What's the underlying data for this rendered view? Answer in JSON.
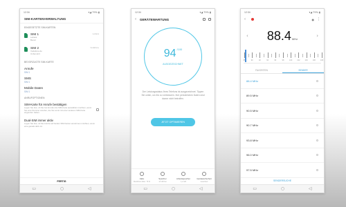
{
  "phone1": {
    "status": {
      "left": "12:34",
      "right": "▾◢ 79% ▮"
    },
    "title": "SIM-KARTENVERWALTUNG",
    "section_installed": "EINGESETZTE SIM-KARTEN",
    "sims": [
      {
        "name": "SIM 1",
        "sub": "Lebara\nBereit",
        "side": "Lebara"
      },
      {
        "name": "SIM 2",
        "sub": "Vodafone.de\nUnbenutzt",
        "side": "Vodafone"
      }
    ],
    "section_preferred": "BEVORZUGTE SIM-KARTE",
    "settings": [
      {
        "title": "Anrufe",
        "sub": "SIM 1"
      },
      {
        "title": "SMS",
        "sub": "SIM 1"
      },
      {
        "title": "Mobile Daten",
        "sub": "SIM 1"
      }
    ],
    "section_more": "ANRUFOPTIONEN",
    "long_items": [
      {
        "title": "SIM-Karte für Anrufe bestätigen",
        "desc": "Legen Sie fest, ob Sie bei Anrufen die SIM-Karte auswählen möchten, wenn Sie eine Nummer anrufen, die Sie sonst mit einer anderen SIM-Karte angerufen haben."
      },
      {
        "title": "Dual-SIM immer aktiv",
        "desc": "Legen Sie fest, ob Sie Anrufe auf beiden SIM-Karten annehmen möchten, wenn eine gerade aktiv ist."
      }
    ],
    "footer": "FERTIG"
  },
  "phone2": {
    "status": {
      "left": "12:34",
      "right": "▾◢ 79% ▮"
    },
    "title": "GERÄTEWARTUNG",
    "score": "94",
    "score_unit": "/100",
    "score_label": "AUSGEZEICHNET",
    "description": "Der Leistungsstatus Ihres Telefons ist ausgezeichnet. Tippen Sie unten, um ihn zu verbessern. Ihre persönlichen Daten sind davon nicht betroffen.",
    "button": "JETZT OPTIMIEREN",
    "grid": [
      {
        "label": "Akku",
        "sub": "Restlicher Akku: 79 %"
      },
      {
        "label": "Speicher",
        "sub": "13 GB frei"
      },
      {
        "label": "Arbeitsspeicher",
        "sub": "1,2 GB"
      },
      {
        "label": "Gerätesicherheit",
        "sub": "Gesichert"
      }
    ]
  },
  "phone3": {
    "status": {
      "left": "12:34",
      "right": "▾◢ 79% ▮"
    },
    "frequency": "88.4",
    "unit": "MHz",
    "scale_labels": [
      "88",
      "90",
      "92",
      "94",
      "96",
      "98",
      "100",
      "102",
      "104",
      "106",
      "108"
    ],
    "tab_favorites": "FAVORITEN",
    "tab_stations": "SENDER",
    "stations": [
      "88.4 MHz",
      "89.5 MHz",
      "90.5 MHz",
      "90.7 MHz",
      "93.8 MHz",
      "96.0 MHz",
      "97.5 MHz"
    ],
    "footer": "SENDERSUCHE",
    "colors": {
      "accent": "#3aa0d8",
      "needle": "#4a90d9"
    }
  }
}
